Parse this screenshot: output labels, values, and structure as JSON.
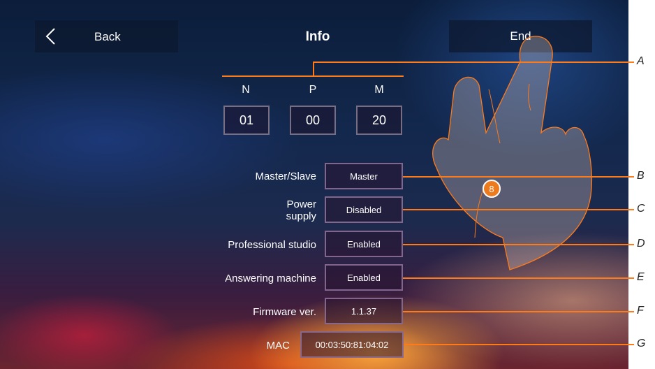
{
  "header": {
    "back_label": "Back",
    "title": "Info",
    "end_label": "End"
  },
  "npm": {
    "labels": [
      "N",
      "P",
      "M"
    ],
    "values": [
      "01",
      "00",
      "20"
    ]
  },
  "rows": [
    {
      "label": "Master/Slave",
      "value": "Master"
    },
    {
      "label": "Power supply",
      "value": "Disabled"
    },
    {
      "label": "Professional studio",
      "value": "Enabled"
    },
    {
      "label": "Answering machine",
      "value": "Enabled"
    },
    {
      "label": "Firmware ver.",
      "value": "1.1.37"
    },
    {
      "label": "MAC",
      "value": "00:03:50:81:04:02"
    }
  ],
  "power_label_line1": "Power",
  "power_label_line2": "supply",
  "badge": "8",
  "callouts": [
    "A",
    "B",
    "C",
    "D",
    "E",
    "F",
    "G"
  ],
  "colors": {
    "accent": "#ff7a18",
    "badge": "#ee7a1e"
  }
}
